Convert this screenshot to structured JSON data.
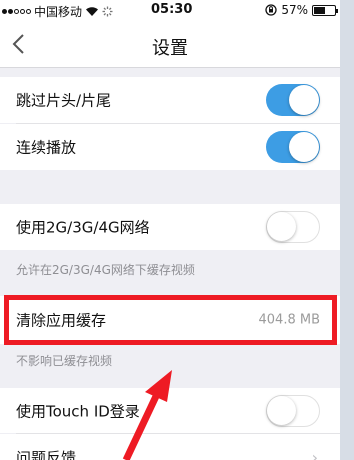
{
  "status_bar": {
    "carrier": "中国移动",
    "time": "05:30",
    "battery": "57%",
    "battery_level": 0.57
  },
  "nav": {
    "title": "设置"
  },
  "settings": {
    "skip_intro": {
      "label": "跳过片头/片尾",
      "on": true
    },
    "autoplay": {
      "label": "连续播放",
      "on": true
    },
    "cellular": {
      "label": "使用2G/3G/4G网络",
      "on": false
    },
    "cellular_note": "允许在2G/3G/4G网络下缓存视频",
    "clear_cache": {
      "label": "清除应用缓存",
      "value": "404.8 MB"
    },
    "clear_cache_note": "不影响已缓存视频",
    "touch_id": {
      "label": "使用Touch ID登录",
      "on": false
    },
    "feedback": {
      "label": "问题反馈"
    }
  },
  "colors": {
    "toggle_on": "#3d9de4",
    "highlight": "#ee1b24"
  }
}
